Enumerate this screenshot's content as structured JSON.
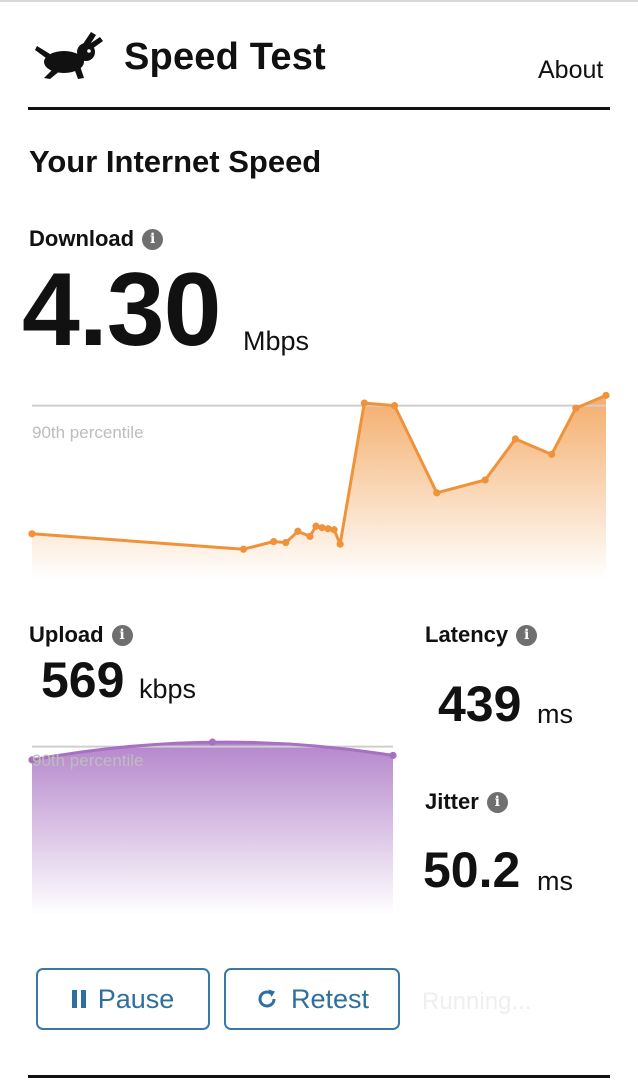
{
  "header": {
    "title": "Speed Test",
    "about_label": "About",
    "logo_icon": "rabbit-icon"
  },
  "main": {
    "title": "Your Internet Speed",
    "download": {
      "label": "Download",
      "value": "4.30",
      "unit": "Mbps",
      "percentile_label": "90th percentile",
      "color": "#f0923a"
    },
    "upload": {
      "label": "Upload",
      "value": "569",
      "unit": "kbps",
      "percentile_label": "90th percentile",
      "color": "#a770c2"
    },
    "latency": {
      "label": "Latency",
      "value": "439",
      "unit": "ms"
    },
    "jitter": {
      "label": "Jitter",
      "value": "50.2",
      "unit": "ms"
    }
  },
  "controls": {
    "pause_label": "Pause",
    "retest_label": "Retest",
    "status": "Running..."
  },
  "chart_data": [
    {
      "type": "area",
      "title": "",
      "x": [
        0,
        35,
        40,
        42,
        44,
        46,
        47,
        48,
        49,
        50,
        51,
        55,
        60,
        67,
        75,
        80,
        86,
        90,
        95
      ],
      "values": [
        0.5,
        0.2,
        0.35,
        0.33,
        0.55,
        0.45,
        0.65,
        0.62,
        0.6,
        0.58,
        0.3,
        3.05,
        3.0,
        1.3,
        1.55,
        2.35,
        2.05,
        2.95,
        3.2
      ],
      "ylim": [
        -0.4,
        3.5
      ],
      "xlim": [
        0,
        95
      ],
      "reference_line": 3.0,
      "reference_label": "90th percentile"
    },
    {
      "type": "area",
      "title": "",
      "x": [
        0,
        1,
        2
      ],
      "values": [
        560,
        600,
        570
      ],
      "ylim": [
        210,
        650
      ],
      "xlim": [
        0,
        2
      ],
      "reference_line": 590,
      "reference_label": "90th percentile"
    }
  ]
}
